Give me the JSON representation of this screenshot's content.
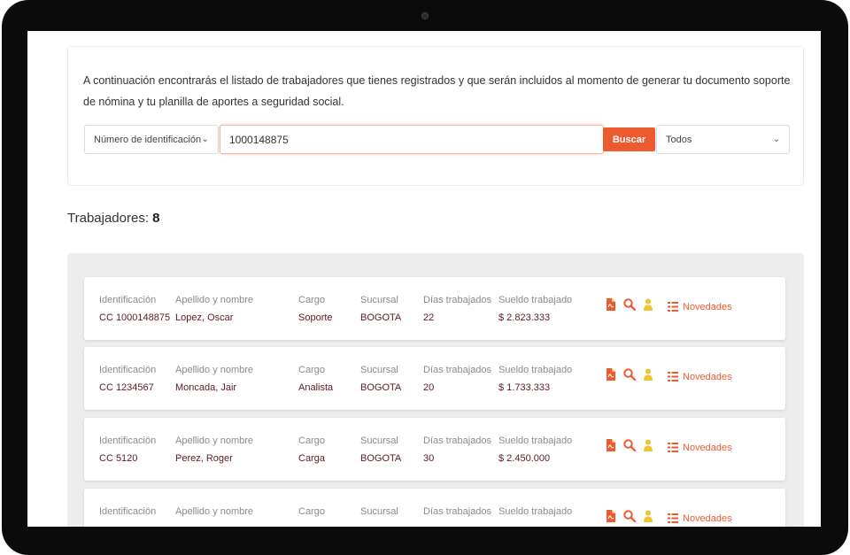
{
  "intro_text": "A continuación encontrarás el listado de trabajadores que tienes registrados y que serán incluidos al momento de generar tu documento soporte de nómina y tu planilla de aportes a seguridad social.",
  "search": {
    "field_selected": "Número de identificación",
    "query_value": "1000148875",
    "button_label": "Buscar",
    "status_selected": "Todos"
  },
  "workers_label": "Trabajadores:",
  "workers_count": "8",
  "columns": {
    "id": "Identificación",
    "name": "Apellido y nombre",
    "cargo": "Cargo",
    "sucursal": "Sucursal",
    "dias": "Días trabajados",
    "sueldo": "Sueldo trabajado"
  },
  "novedades_label": "Novedades",
  "colors": {
    "accent": "#ec5b2f",
    "value_text": "#5c1a22",
    "user_icon": "#f2c230"
  },
  "icons": [
    "pdf-document-icon",
    "search-icon",
    "user-icon",
    "list-icon"
  ],
  "rows": [
    {
      "id": "CC 1000148875",
      "name": "Lopez, Oscar",
      "cargo": "Soporte",
      "sucursal": "BOGOTA",
      "dias": "22",
      "sueldo": "$ 2.823.333"
    },
    {
      "id": "CC 1234567",
      "name": "Moncada, Jair",
      "cargo": "Analista",
      "sucursal": "BOGOTA",
      "dias": "20",
      "sueldo": "$ 1.733.333"
    },
    {
      "id": "CC 5120",
      "name": "Perez, Roger",
      "cargo": "Carga",
      "sucursal": "BOGOTA",
      "dias": "30",
      "sueldo": "$ 2.450.000"
    },
    {
      "id": "",
      "name": "",
      "cargo": "",
      "sucursal": "",
      "dias": "",
      "sueldo": ""
    }
  ]
}
